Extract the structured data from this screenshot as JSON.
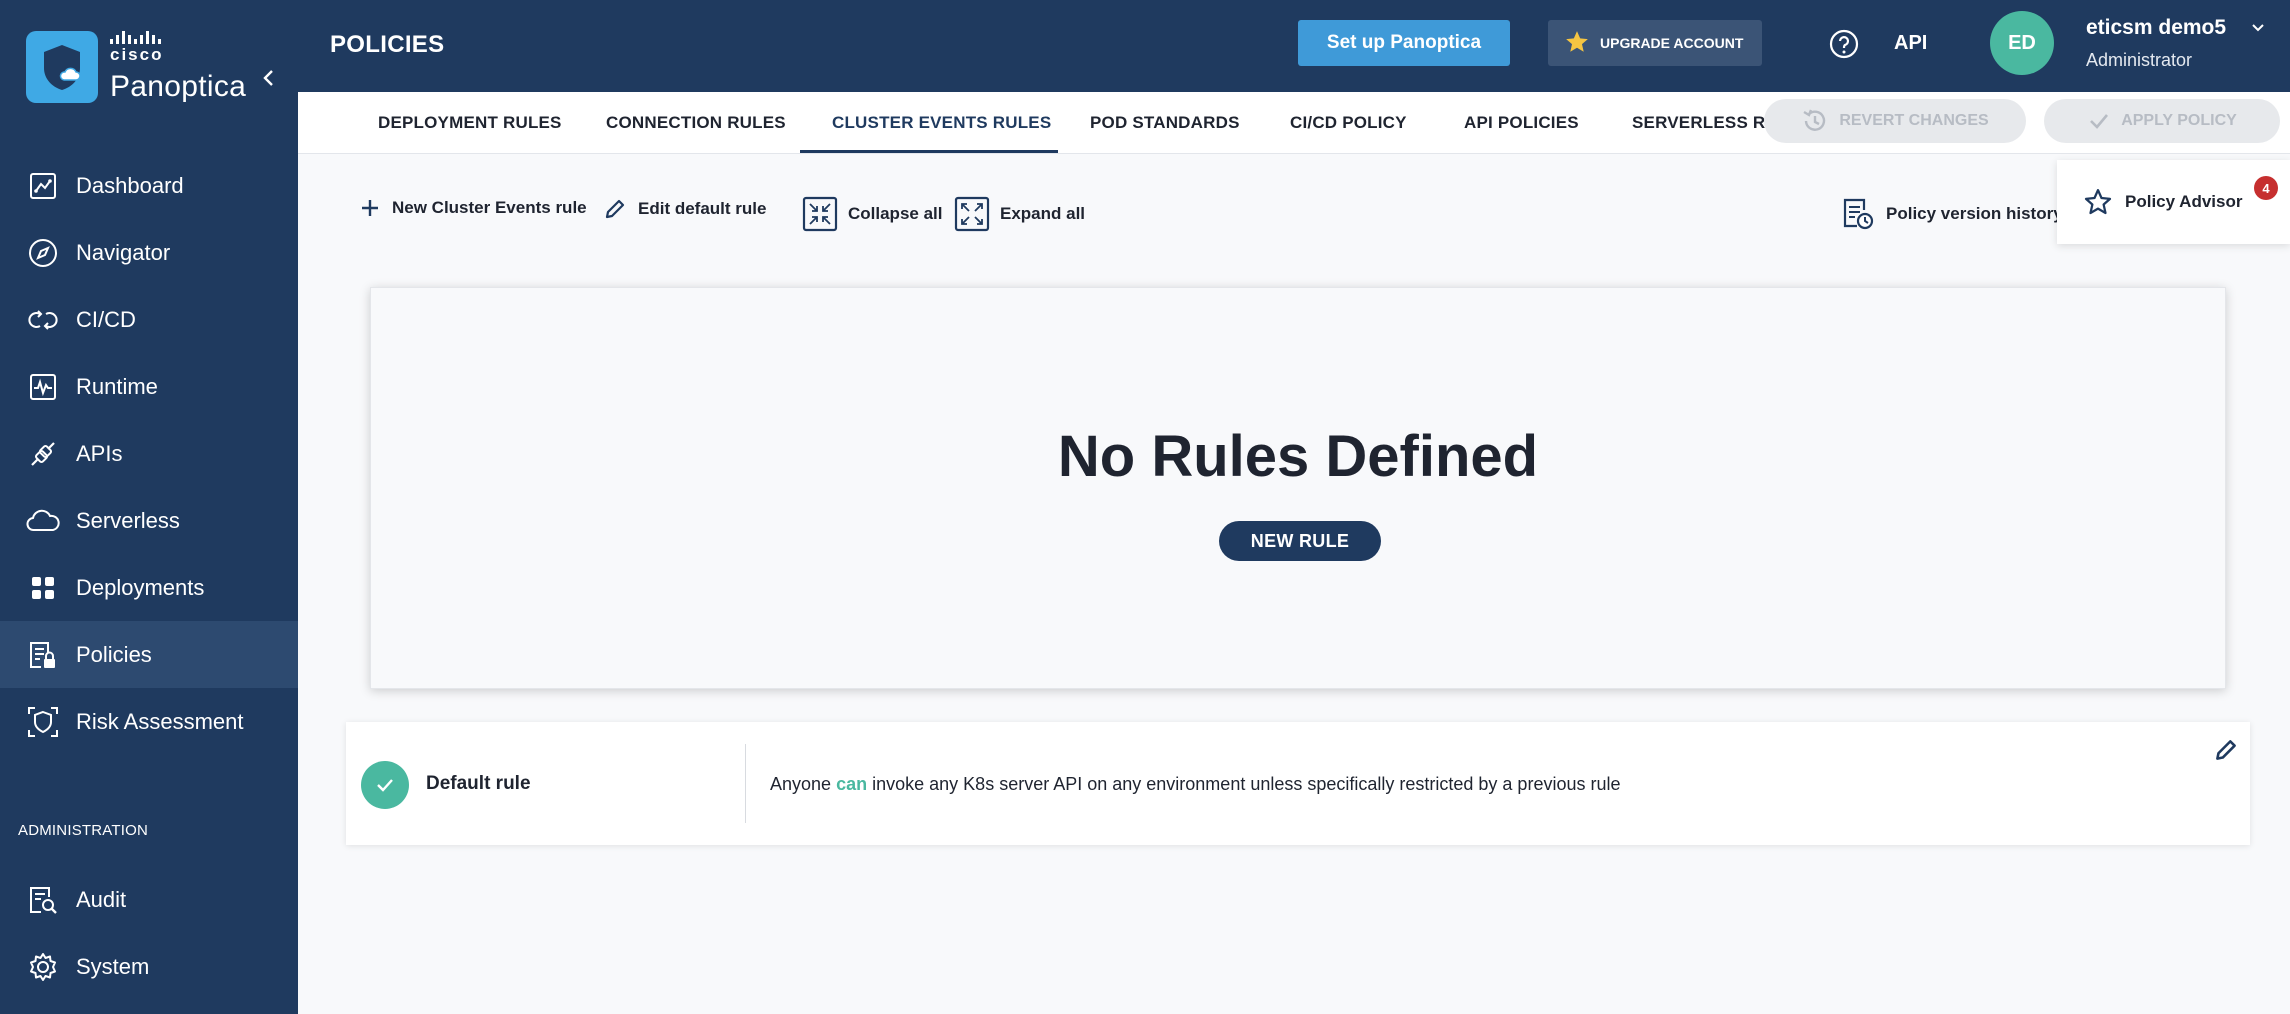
{
  "brand": {
    "company": "cisco",
    "product": "Panoptica"
  },
  "sidebar": {
    "items": [
      {
        "label": "Dashboard",
        "icon": "dashboard-icon",
        "active": false
      },
      {
        "label": "Navigator",
        "icon": "compass-icon",
        "active": false
      },
      {
        "label": "CI/CD",
        "icon": "cicd-icon",
        "active": false
      },
      {
        "label": "Runtime",
        "icon": "runtime-icon",
        "active": false
      },
      {
        "label": "APIs",
        "icon": "api-icon",
        "active": false
      },
      {
        "label": "Serverless",
        "icon": "cloud-icon",
        "active": false
      },
      {
        "label": "Deployments",
        "icon": "grid-icon",
        "active": false
      },
      {
        "label": "Policies",
        "icon": "policy-icon",
        "active": true
      },
      {
        "label": "Risk Assessment",
        "icon": "shield-scan-icon",
        "active": false
      }
    ],
    "admin_section": "ADMINISTRATION",
    "admin_items": [
      {
        "label": "Audit",
        "icon": "audit-icon"
      },
      {
        "label": "System",
        "icon": "gear-icon"
      }
    ]
  },
  "header": {
    "title": "POLICIES",
    "setup_label": "Set up Panoptica",
    "upgrade_label": "UPGRADE ACCOUNT",
    "api_label": "API",
    "user": {
      "initials": "ED",
      "name": "eticsm demo5",
      "role": "Administrator"
    }
  },
  "tabs": [
    {
      "label": "DEPLOYMENT RULES",
      "active": false
    },
    {
      "label": "CONNECTION RULES",
      "active": false
    },
    {
      "label": "CLUSTER EVENTS RULES",
      "active": true
    },
    {
      "label": "POD STANDARDS",
      "active": false
    },
    {
      "label": "CI/CD POLICY",
      "active": false
    },
    {
      "label": "API POLICIES",
      "active": false
    },
    {
      "label": "SERVERLESS RUL",
      "active": false
    }
  ],
  "actions": {
    "revert_label": "REVERT CHANGES",
    "apply_label": "APPLY POLICY"
  },
  "toolbar": {
    "new_rule": "New Cluster Events rule",
    "edit_default": "Edit default rule",
    "collapse_all": "Collapse all",
    "expand_all": "Expand all",
    "version_history": "Policy version history"
  },
  "advisor": {
    "label": "Policy Advisor",
    "badge": "4"
  },
  "empty_state": {
    "title": "No Rules Defined",
    "button": "NEW RULE"
  },
  "default_rule": {
    "label": "Default rule",
    "text_prefix": "Anyone",
    "text_action": "can",
    "text_suffix": "invoke any K8s server API on any environment unless specifically restricted by a previous rule"
  },
  "colors": {
    "navy": "#1f3a5f",
    "accent_blue": "#3f9ad8",
    "teal": "#4ab8a0",
    "badge_red": "#c62f2f"
  }
}
